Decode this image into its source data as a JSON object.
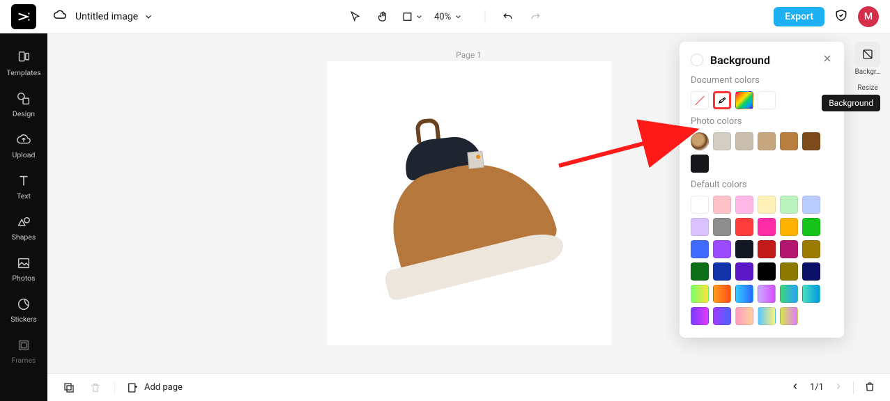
{
  "header": {
    "doc_title": "Untitled image",
    "zoom_label": "40%",
    "export_label": "Export",
    "avatar_initial": "M"
  },
  "sidebar": {
    "items": [
      {
        "label": "Templates"
      },
      {
        "label": "Design"
      },
      {
        "label": "Upload"
      },
      {
        "label": "Text"
      },
      {
        "label": "Shapes"
      },
      {
        "label": "Photos"
      },
      {
        "label": "Stickers"
      },
      {
        "label": "Frames"
      }
    ]
  },
  "canvas": {
    "page_label": "Page 1"
  },
  "footer": {
    "add_page_label": "Add page",
    "pager_label": "1/1"
  },
  "right_rail": {
    "items": [
      {
        "label": "Backgr…"
      },
      {
        "label": "Resize"
      }
    ],
    "tooltip": "Background"
  },
  "bg_panel": {
    "title": "Background",
    "sections": {
      "document_colors": "Document colors",
      "photo_colors": "Photo colors",
      "default_colors": "Default colors"
    },
    "photo_colors": [
      "#d3cec4",
      "#c9bdae",
      "#c6a77f",
      "#b87f3e",
      "#7c4a1b",
      "#17171a"
    ],
    "default_colors_rows": [
      [
        "#ffffff",
        "#ffc2c7",
        "#ffb8e6",
        "#fff0b8",
        "#b9f2bc",
        "#b9ccff",
        "#d9c2ff"
      ],
      [
        "#8d8d8d",
        "#ff3b3b",
        "#ff2ea6",
        "#ffb300",
        "#17c41c",
        "#3f6bff",
        "#9a4bff"
      ],
      [
        "#131722",
        "#c11b1b",
        "#b3166e",
        "#9a7a00",
        "#0c6f18",
        "#1233a8",
        "#5d18c6"
      ],
      [
        "#000000",
        "#8c7a00",
        "#0c0f66",
        "g:linear-gradient(90deg,#7bff67,#ffe23b)",
        "g:linear-gradient(90deg,#ff9c1a,#ff4d1a)",
        "g:linear-gradient(90deg,#35c9ff,#2a69ff)",
        "g:linear-gradient(90deg,#c7a9ff,#d84bff)"
      ],
      [
        "g:linear-gradient(90deg,#3ed67a,#2aa0ff)",
        "g:linear-gradient(90deg,#49e0c0,#0099e0)",
        "g:linear-gradient(90deg,#7a3bff,#e23bff)",
        "g:linear-gradient(90deg,#a03bff,#4b63ff)",
        "g:linear-gradient(90deg,#ff9cc2,#ffd29c)",
        "g:linear-gradient(90deg,#5bc6ff,#fff27a)",
        "g:linear-gradient(90deg,#d6e84a,#e07aff)"
      ]
    ]
  }
}
